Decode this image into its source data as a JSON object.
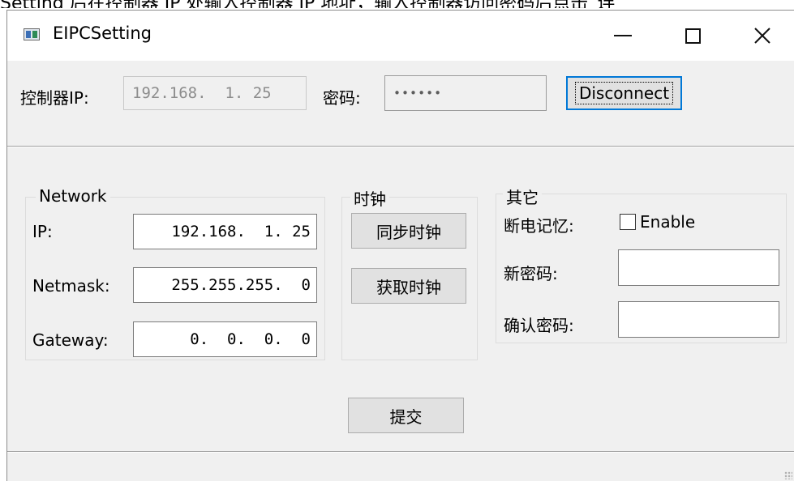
{
  "top_partial_text": "Setting 后在控制器 IP 处输入控制器 IP 地址，输入控制器访问密码后点击“连",
  "window": {
    "title": "EIPCSetting",
    "icon": "app-window-icon"
  },
  "connection": {
    "controller_ip_label": "控制器IP:",
    "controller_ip_value": "192.168.  1. 25",
    "password_label": "密码:",
    "password_value": "••••••",
    "disconnect_label": "Disconnect"
  },
  "network": {
    "title": "Network",
    "ip_label": "IP:",
    "ip_value": "192.168.  1. 25",
    "netmask_label": "Netmask:",
    "netmask_value": "255.255.255.  0",
    "gateway_label": "Gateway:",
    "gateway_value": "  0.  0.  0.  0"
  },
  "clock": {
    "title": "时钟",
    "sync_label": "同步时钟",
    "get_label": "获取时钟"
  },
  "other": {
    "title": "其它",
    "power_memory_label": "断电记忆:",
    "enable_label": "Enable",
    "enable_checked": false,
    "new_password_label": "新密码:",
    "new_password_value": "",
    "confirm_password_label": "确认密码:",
    "confirm_password_value": ""
  },
  "submit_label": "提交"
}
